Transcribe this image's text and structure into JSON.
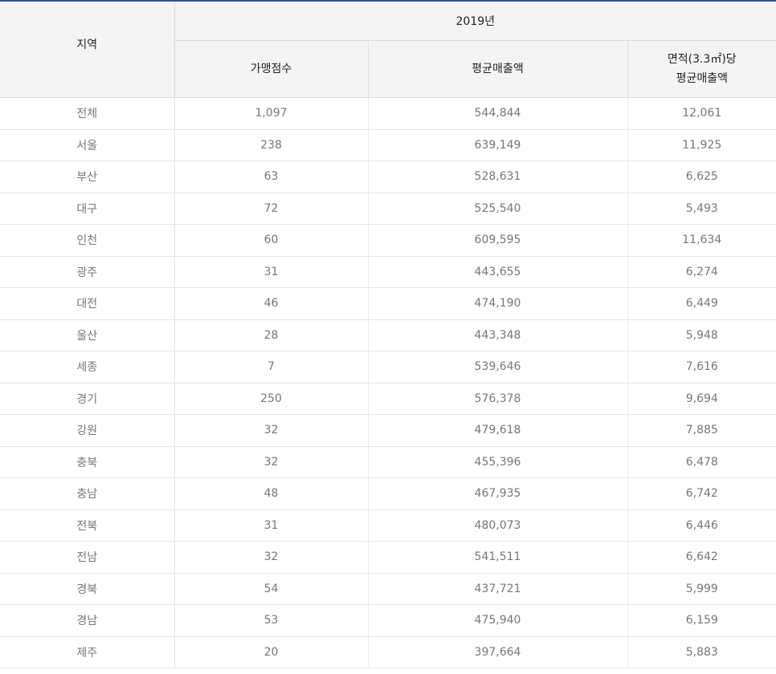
{
  "table": {
    "header": {
      "region": "지역",
      "year": "2019년",
      "count": "가맹점수",
      "avg_sales": "평균매출액",
      "area_sales_line1": "면적(3.3㎡)당",
      "area_sales_line2": "평균매출액"
    },
    "rows": [
      {
        "region": "전체",
        "count": "1,097",
        "avg_sales": "544,844",
        "area_sales": "12,061"
      },
      {
        "region": "서울",
        "count": "238",
        "avg_sales": "639,149",
        "area_sales": "11,925"
      },
      {
        "region": "부산",
        "count": "63",
        "avg_sales": "528,631",
        "area_sales": "6,625"
      },
      {
        "region": "대구",
        "count": "72",
        "avg_sales": "525,540",
        "area_sales": "5,493"
      },
      {
        "region": "인천",
        "count": "60",
        "avg_sales": "609,595",
        "area_sales": "11,634"
      },
      {
        "region": "광주",
        "count": "31",
        "avg_sales": "443,655",
        "area_sales": "6,274"
      },
      {
        "region": "대전",
        "count": "46",
        "avg_sales": "474,190",
        "area_sales": "6,449"
      },
      {
        "region": "울산",
        "count": "28",
        "avg_sales": "443,348",
        "area_sales": "5,948"
      },
      {
        "region": "세종",
        "count": "7",
        "avg_sales": "539,646",
        "area_sales": "7,616"
      },
      {
        "region": "경기",
        "count": "250",
        "avg_sales": "576,378",
        "area_sales": "9,694"
      },
      {
        "region": "강원",
        "count": "32",
        "avg_sales": "479,618",
        "area_sales": "7,885"
      },
      {
        "region": "충북",
        "count": "32",
        "avg_sales": "455,396",
        "area_sales": "6,478"
      },
      {
        "region": "충남",
        "count": "48",
        "avg_sales": "467,935",
        "area_sales": "6,742"
      },
      {
        "region": "전북",
        "count": "31",
        "avg_sales": "480,073",
        "area_sales": "6,446"
      },
      {
        "region": "전남",
        "count": "32",
        "avg_sales": "541,511",
        "area_sales": "6,642"
      },
      {
        "region": "경북",
        "count": "54",
        "avg_sales": "437,721",
        "area_sales": "5,999"
      },
      {
        "region": "경남",
        "count": "53",
        "avg_sales": "475,940",
        "area_sales": "6,159"
      },
      {
        "region": "제주",
        "count": "20",
        "avg_sales": "397,664",
        "area_sales": "5,883"
      }
    ]
  }
}
